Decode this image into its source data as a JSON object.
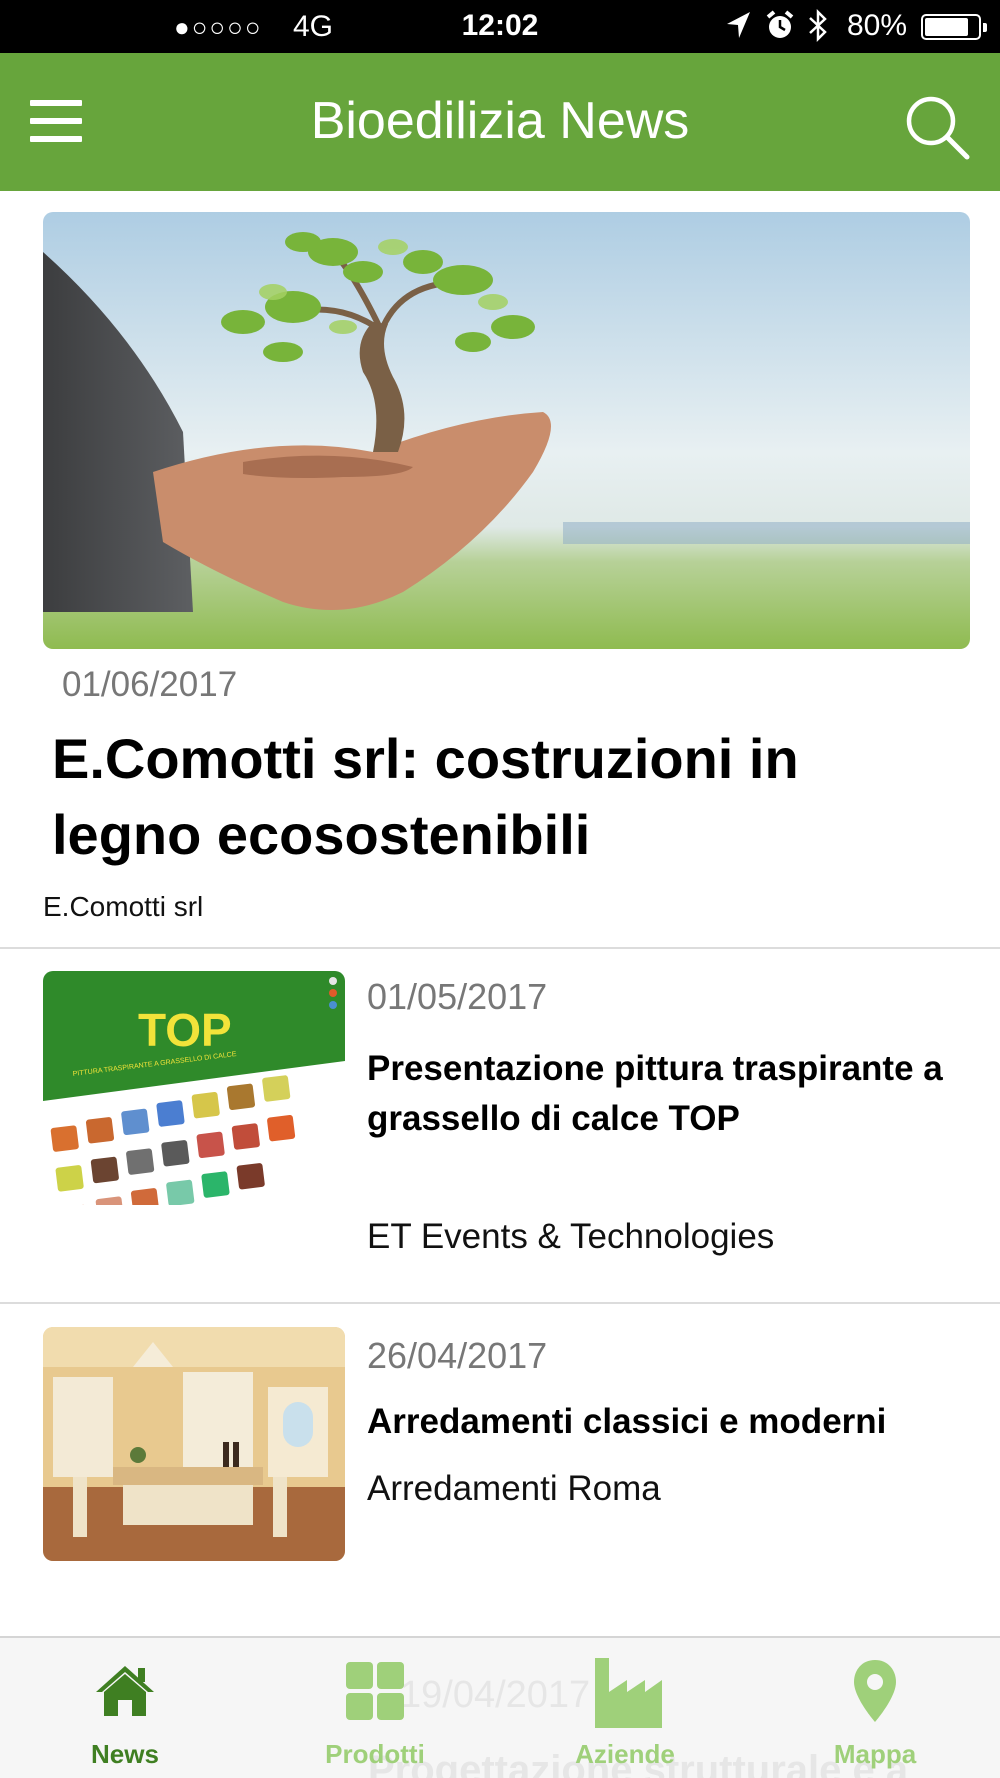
{
  "status_bar": {
    "signal": "●○○○○",
    "network": "4G",
    "time": "12:02",
    "battery": "80%",
    "battery_level": 0.8
  },
  "header": {
    "title": "Bioedilizia News"
  },
  "featured": {
    "date": "01/06/2017",
    "headline": "E.Comotti srl: costruzioni in legno ecosostenibili",
    "source": "E.Comotti srl"
  },
  "articles": [
    {
      "date": "01/05/2017",
      "headline": "Presentazione pittura traspirante a grassello di calce TOP",
      "source": "ET Events & Technologies",
      "thumb_text": "TOP",
      "thumb_subtitle": "PITTURA TRASPIRANTE A GRASSELLO DI CALCE"
    },
    {
      "date": "26/04/2017",
      "headline": "Arredamenti classici e moderni",
      "source": "Arredamenti Roma"
    }
  ],
  "partial_item": {
    "date": "19/04/2017",
    "headline": "Progettazione strutturale e a"
  },
  "tabs": [
    {
      "label": "News",
      "icon": "home-icon",
      "active": true
    },
    {
      "label": "Prodotti",
      "icon": "grid-icon",
      "active": false
    },
    {
      "label": "Aziende",
      "icon": "factory-icon",
      "active": false
    },
    {
      "label": "Mappa",
      "icon": "map-pin-icon",
      "active": false
    }
  ],
  "colors": {
    "brand_green": "#67a53c",
    "tab_active": "#3f7f22",
    "tab_inactive": "#9fd07a",
    "date_gray": "#777777"
  }
}
